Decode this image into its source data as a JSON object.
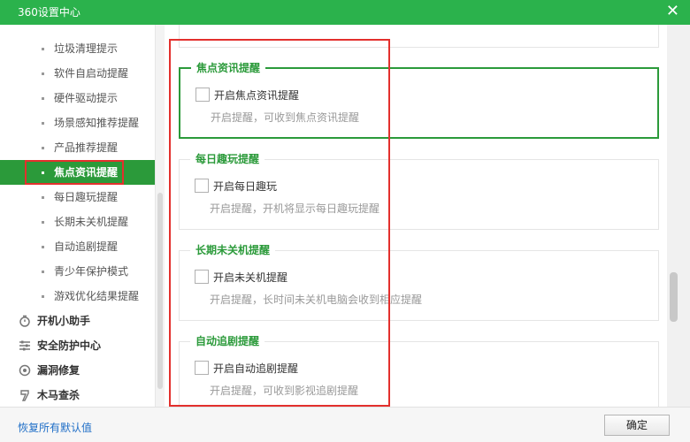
{
  "window": {
    "title": "360设置中心",
    "close_glyph": "✕"
  },
  "sidebar": {
    "items": [
      {
        "label": "垃圾清理提示"
      },
      {
        "label": "软件自启动提醒"
      },
      {
        "label": "硬件驱动提示"
      },
      {
        "label": "场景感知推荐提醒"
      },
      {
        "label": "产品推荐提醒"
      },
      {
        "label": "焦点资讯提醒",
        "active": true
      },
      {
        "label": "每日趣玩提醒"
      },
      {
        "label": "长期未关机提醒"
      },
      {
        "label": "自动追剧提醒"
      },
      {
        "label": "青少年保护模式"
      },
      {
        "label": "游戏优化结果提醒"
      }
    ],
    "groups": [
      {
        "label": "开机小助手",
        "icon": "timer-icon"
      },
      {
        "label": "安全防护中心",
        "icon": "sliders-icon"
      },
      {
        "label": "漏洞修复",
        "icon": "patch-icon"
      },
      {
        "label": "木马查杀",
        "icon": "scan-icon"
      }
    ]
  },
  "sections": [
    {
      "title": "焦点资讯提醒",
      "checkbox_label": "开启焦点资讯提醒",
      "checked": false,
      "description": "开启提醒，可收到焦点资讯提醒"
    },
    {
      "title": "每日趣玩提醒",
      "checkbox_label": "开启每日趣玩",
      "checked": false,
      "description": "开启提醒，开机将显示每日趣玩提醒"
    },
    {
      "title": "长期未关机提醒",
      "checkbox_label": "开启未关机提醒",
      "checked": false,
      "description": "开启提醒，长时间未关机电脑会收到相应提醒"
    },
    {
      "title": "自动追剧提醒",
      "checkbox_label": "开启自动追剧提醒",
      "checked": false,
      "description": "开启提醒，可收到影视追剧提醒"
    }
  ],
  "footer": {
    "restore_label": "恢复所有默认值",
    "ok_label": "确定"
  },
  "colors": {
    "titlebar": "#2bb24c",
    "accent": "#2b9a3a",
    "highlight": "#e3302d",
    "link": "#1f6ec7"
  }
}
